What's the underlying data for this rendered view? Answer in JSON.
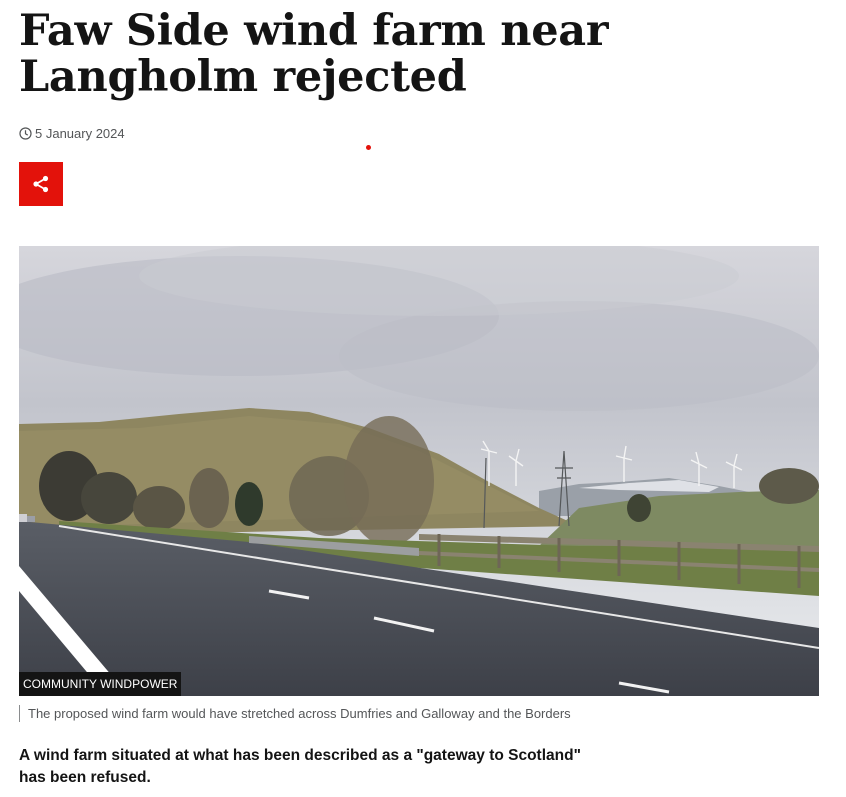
{
  "article": {
    "headline": "Faw Side wind farm near Langholm rejected",
    "date": "5 January 2024",
    "lead": "A wind farm situated at what has been described as a \"gateway to Scotland\" has been refused."
  },
  "share": {
    "icon": "share-icon"
  },
  "image": {
    "credit": "COMMUNITY WINDPOWER",
    "caption": "The proposed wind farm would have stretched across Dumfries and Galloway and the Borders"
  },
  "colors": {
    "accent": "#e3120b",
    "text": "#141414",
    "meta": "#545658"
  }
}
